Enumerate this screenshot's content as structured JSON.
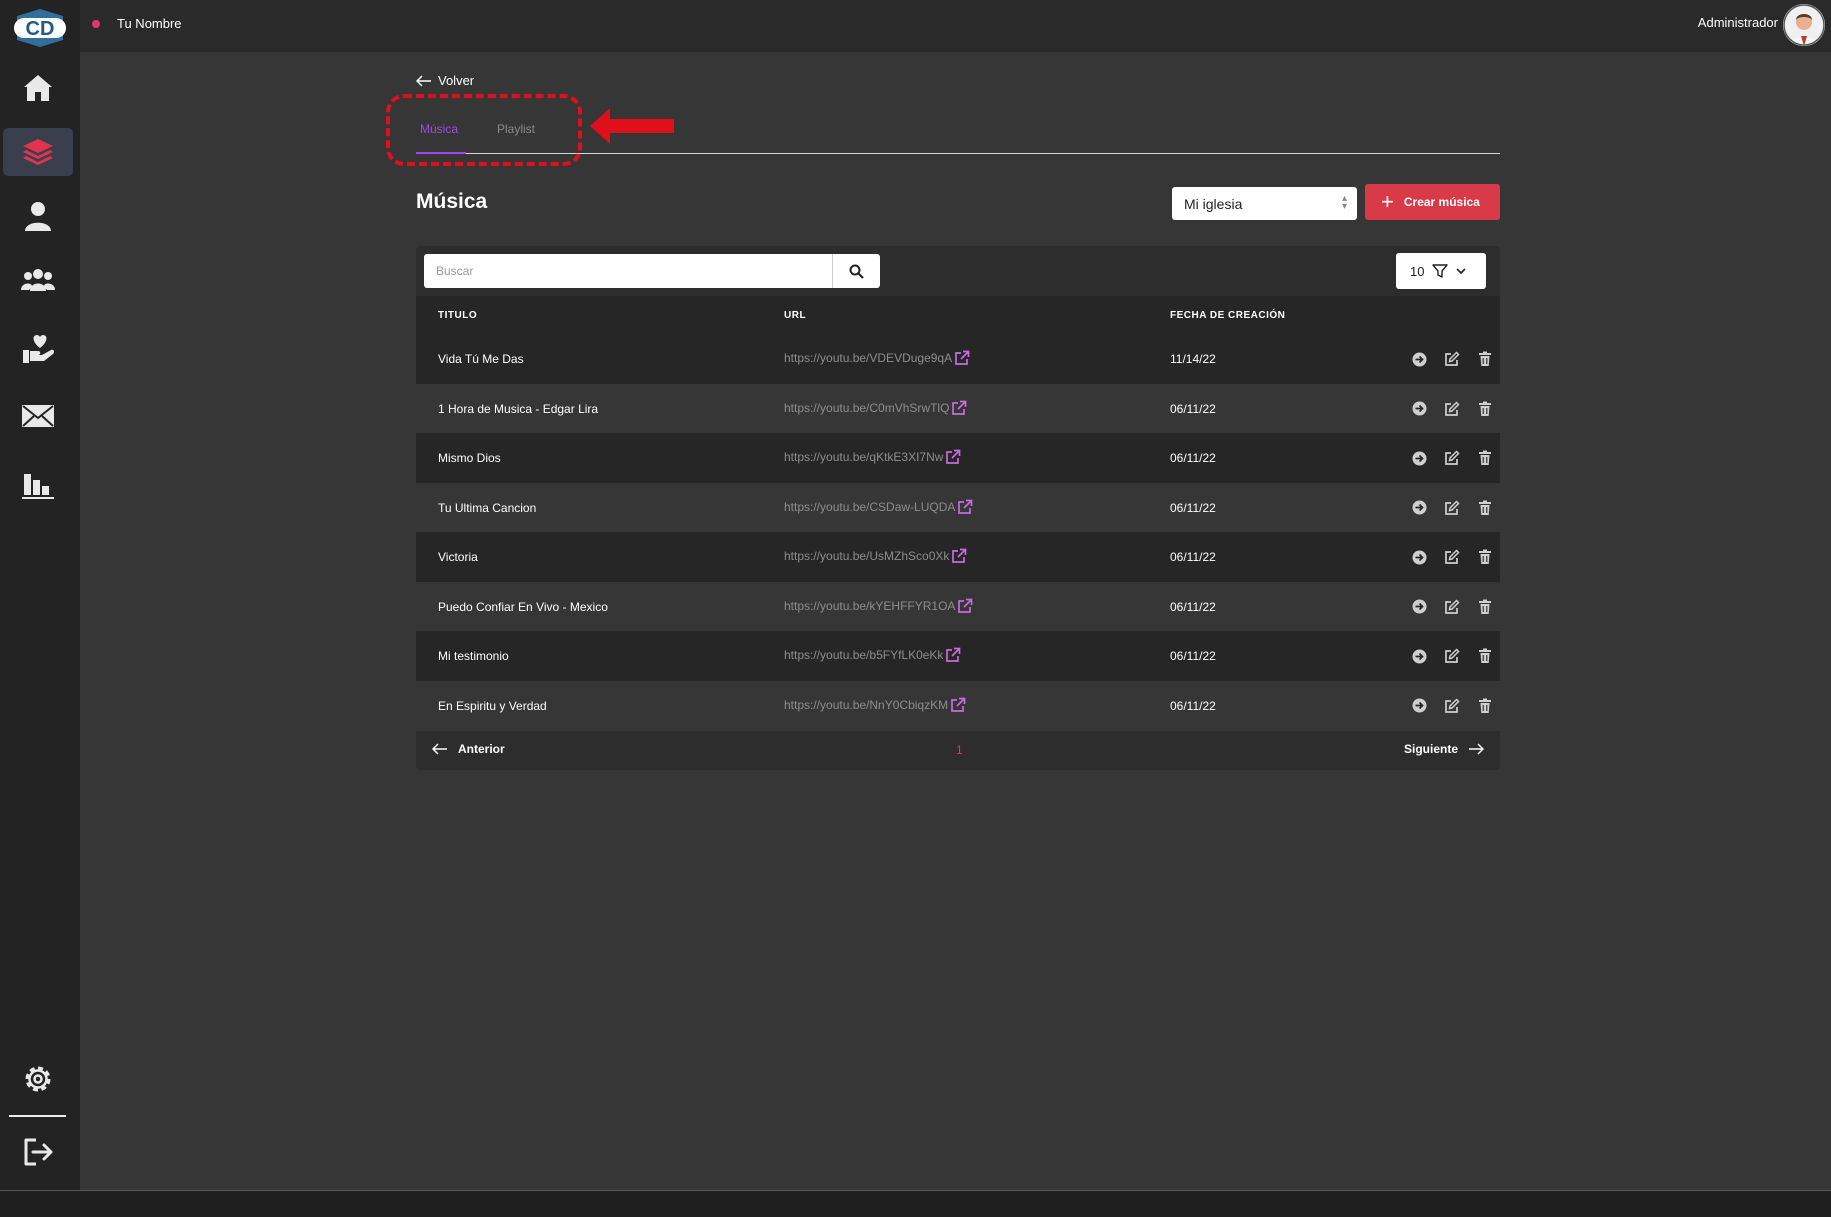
{
  "topbar": {
    "user_name": "Tu Nombre",
    "role": "Administrador"
  },
  "logo": {
    "text": "CD"
  },
  "sidebar": {
    "items": [
      {
        "name": "home-icon"
      },
      {
        "name": "layers-icon",
        "active": true
      },
      {
        "name": "user-icon"
      },
      {
        "name": "group-icon"
      },
      {
        "name": "donation-icon"
      },
      {
        "name": "mail-icon"
      },
      {
        "name": "stats-icon"
      },
      {
        "name": "gear-icon"
      },
      {
        "name": "logout-icon"
      }
    ]
  },
  "nav": {
    "back_label": "Volver"
  },
  "tabs": [
    {
      "label": "Música",
      "active": true
    },
    {
      "label": "Playlist",
      "active": false
    }
  ],
  "page": {
    "title": "Música",
    "church_select": "Mi iglesia",
    "create_button": "Crear música"
  },
  "table": {
    "search_placeholder": "Buscar",
    "page_size": "10",
    "headers": {
      "title": "TITULO",
      "url": "URL",
      "date": "FECHA DE CREACIÓN"
    },
    "rows": [
      {
        "title": "Vida Tú Me Das",
        "url": "https://youtu.be/VDEVDuge9qA",
        "date": "11/14/22"
      },
      {
        "title": "1 Hora de Musica - Edgar Lira",
        "url": "https://youtu.be/C0mVhSrwTlQ",
        "date": "06/11/22"
      },
      {
        "title": "Mismo Dios",
        "url": "https://youtu.be/qKtkE3XI7Nw",
        "date": "06/11/22"
      },
      {
        "title": "Tu Ultima Cancion",
        "url": "https://youtu.be/CSDaw-LUQDA",
        "date": "06/11/22"
      },
      {
        "title": "Victoria",
        "url": "https://youtu.be/UsMZhSco0Xk",
        "date": "06/11/22"
      },
      {
        "title": "Puedo Confiar En Vivo - Mexico",
        "url": "https://youtu.be/kYEHFFYR1OA",
        "date": "06/11/22"
      },
      {
        "title": "Mi testimonio",
        "url": "https://youtu.be/b5FYfLK0eKk",
        "date": "06/11/22"
      },
      {
        "title": "En Espiritu y Verdad",
        "url": "https://youtu.be/NnY0CbiqzKM",
        "date": "06/11/22"
      }
    ]
  },
  "pagination": {
    "prev": "Anterior",
    "current": "1",
    "next": "Siguiente"
  },
  "colors": {
    "accent_purple": "#a347e8",
    "accent_red": "#d93a48",
    "annotation_red": "#e0101b",
    "link_icon": "#c86be0"
  }
}
